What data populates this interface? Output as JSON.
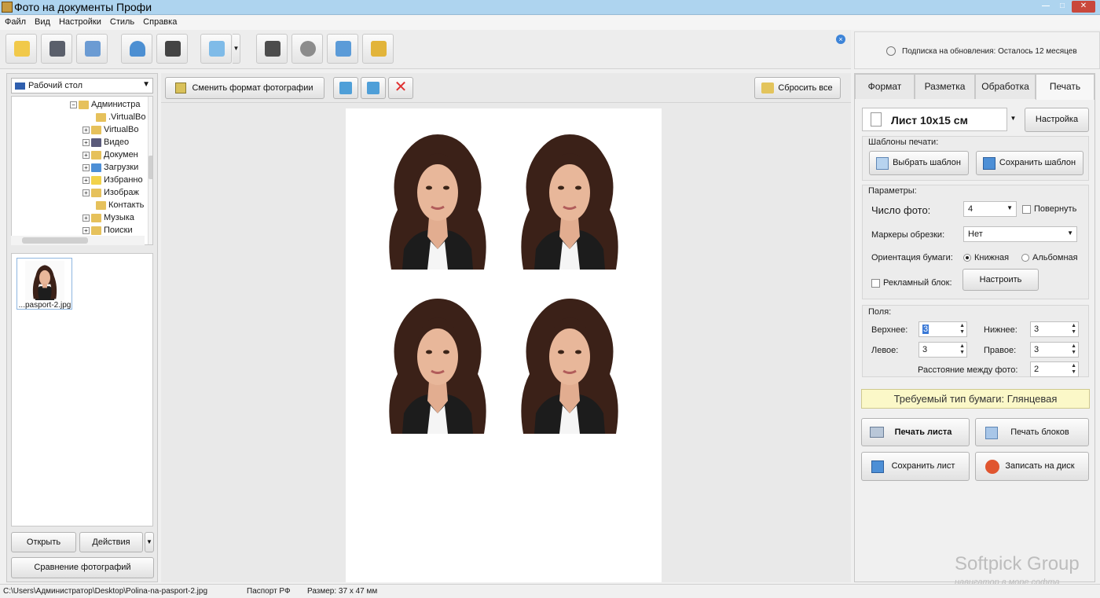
{
  "window": {
    "title": "Фото на документы Профи",
    "buttons": [
      "—",
      "□",
      "✕"
    ]
  },
  "menu": [
    "Файл",
    "Вид",
    "Настройки",
    "Стиль",
    "Справка"
  ],
  "toolbar_icons": [
    "open-folder-icon",
    "save-icon",
    "print-icon",
    "person-icon",
    "camera-icon",
    "image-edit-icon",
    "book-help-icon",
    "video-film-icon",
    "home-icon",
    "cart-icon"
  ],
  "subscription": "Подписка на обновления: Осталось 12 месяцев",
  "explorer": {
    "location": "Рабочий стол",
    "tree": [
      "Администра",
      ".VirtualBo",
      "VirtualBo",
      "Видео",
      "Докумен",
      "Загрузки",
      "Избранно",
      "Изображ",
      "Контакть",
      "Музыка",
      "Поиски"
    ],
    "thumb_caption": "...pasport-2.jpg"
  },
  "left_buttons": {
    "open": "Открыть",
    "actions": "Действия",
    "compare": "Сравнение фотографий"
  },
  "center_toolbar": {
    "change_format": "Сменить формат фотографии",
    "reset_all": "Сбросить все"
  },
  "tabs": [
    "Формат",
    "Разметка",
    "Обработка",
    "Печать"
  ],
  "print": {
    "sheet": "Лист 10x15 см",
    "settings": "Настройка",
    "templates_title": "Шаблоны печати:",
    "choose_template": "Выбрать шаблон",
    "save_template": "Сохранить шаблон",
    "params_title": "Параметры:",
    "count_label": "Число фото:",
    "count_value": "4",
    "rotate_label": "Повернуть",
    "markers_label": "Маркеры обрезки:",
    "markers_value": "Нет",
    "orientation_label": "Ориентация бумаги:",
    "portrait": "Книжная",
    "landscape": "Альбомная",
    "ad_label": "Рекламный блок:",
    "ad_configure": "Настроить",
    "margins_title": "Поля:",
    "top_label": "Верхнее:",
    "top_value": "3",
    "bottom_label": "Нижнее:",
    "bottom_value": "3",
    "left_label": "Левое:",
    "left_value": "3",
    "right_label": "Правое:",
    "right_value": "3",
    "spacing_label": "Расстояние между фото:",
    "spacing_value": "2",
    "paper_type": "Требуемый тип бумаги: Глянцевая",
    "print_sheet": "Печать листа",
    "print_blocks": "Печать блоков",
    "save_sheet": "Сохранить лист",
    "burn_disc": "Записать на диск"
  },
  "status": {
    "path": "C:\\Users\\Администратор\\Desktop\\Polina-na-pasport-2.jpg",
    "format": "Паспорт РФ",
    "size": "Размер: 37 x 47 мм"
  },
  "watermark": {
    "brand": "Softpick Group",
    "tagline": "навигатор в море софта"
  },
  "colors": {
    "titlebar": "#aed4ef",
    "paper_type_bg": "#fbf8c8",
    "hair": "#3b2118",
    "skin": "#e8b79a"
  }
}
